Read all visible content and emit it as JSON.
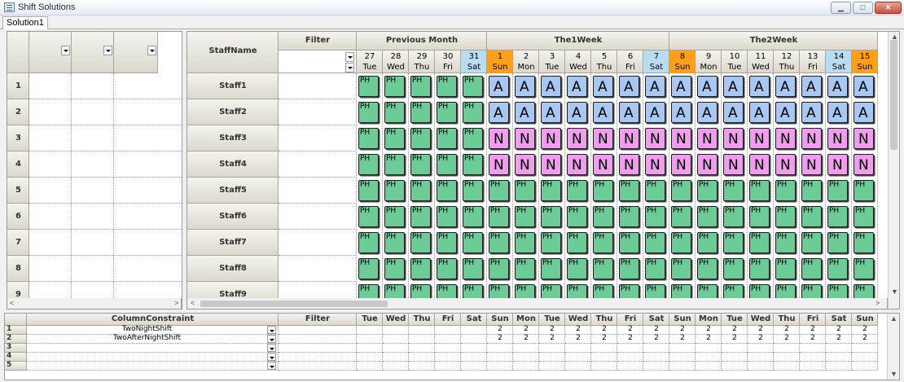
{
  "window": {
    "title": "Shift Solutions",
    "min_glyph": "▁",
    "max_glyph": "□",
    "close_glyph": "✕"
  },
  "tabs": [
    {
      "label": "Solution1"
    }
  ],
  "grid": {
    "staff_header": "StaffName",
    "filter_header": "Filter",
    "week_headers": [
      "Previous Month",
      "The1Week",
      "The2Week"
    ],
    "days": [
      {
        "date": "27",
        "day": "Tue",
        "kind": "prev"
      },
      {
        "date": "28",
        "day": "Wed",
        "kind": "prev"
      },
      {
        "date": "29",
        "day": "Thu",
        "kind": "prev"
      },
      {
        "date": "30",
        "day": "Fri",
        "kind": "prev"
      },
      {
        "date": "31",
        "day": "Sat",
        "kind": "sat"
      },
      {
        "date": "1",
        "day": "Sun",
        "kind": "sun"
      },
      {
        "date": "2",
        "day": "Mon",
        "kind": "wk"
      },
      {
        "date": "3",
        "day": "Tue",
        "kind": "wk"
      },
      {
        "date": "4",
        "day": "Wed",
        "kind": "wk"
      },
      {
        "date": "5",
        "day": "Thu",
        "kind": "wk"
      },
      {
        "date": "6",
        "day": "Fri",
        "kind": "wk"
      },
      {
        "date": "7",
        "day": "Sat",
        "kind": "sat"
      },
      {
        "date": "8",
        "day": "Sun",
        "kind": "sun"
      },
      {
        "date": "9",
        "day": "Mon",
        "kind": "wk"
      },
      {
        "date": "10",
        "day": "Tue",
        "kind": "wk"
      },
      {
        "date": "11",
        "day": "Wed",
        "kind": "wk"
      },
      {
        "date": "12",
        "day": "Thu",
        "kind": "wk"
      },
      {
        "date": "13",
        "day": "Fri",
        "kind": "wk"
      },
      {
        "date": "14",
        "day": "Sat",
        "kind": "sat"
      },
      {
        "date": "15",
        "day": "Sun",
        "kind": "sun"
      }
    ],
    "rows": [
      {
        "num": "1",
        "staff": "Staff1",
        "shifts": [
          "PH",
          "PH",
          "PH",
          "PH",
          "PH",
          "A",
          "A",
          "A",
          "A",
          "A",
          "A",
          "A",
          "A",
          "A",
          "A",
          "A",
          "A",
          "A",
          "A",
          "A"
        ]
      },
      {
        "num": "2",
        "staff": "Staff2",
        "shifts": [
          "PH",
          "PH",
          "PH",
          "PH",
          "PH",
          "A",
          "A",
          "A",
          "A",
          "A",
          "A",
          "A",
          "A",
          "A",
          "A",
          "A",
          "A",
          "A",
          "A",
          "A"
        ]
      },
      {
        "num": "3",
        "staff": "Staff3",
        "shifts": [
          "PH",
          "PH",
          "PH",
          "PH",
          "PH",
          "N",
          "N",
          "N",
          "N",
          "N",
          "N",
          "N",
          "N",
          "N",
          "N",
          "N",
          "N",
          "N",
          "N",
          "N"
        ]
      },
      {
        "num": "4",
        "staff": "Staff4",
        "shifts": [
          "PH",
          "PH",
          "PH",
          "PH",
          "PH",
          "N",
          "N",
          "N",
          "N",
          "N",
          "N",
          "N",
          "N",
          "N",
          "N",
          "N",
          "N",
          "N",
          "N",
          "N"
        ]
      },
      {
        "num": "5",
        "staff": "Staff5",
        "shifts": [
          "PH",
          "PH",
          "PH",
          "PH",
          "PH",
          "PH",
          "PH",
          "PH",
          "PH",
          "PH",
          "PH",
          "PH",
          "PH",
          "PH",
          "PH",
          "PH",
          "PH",
          "PH",
          "PH",
          "PH"
        ]
      },
      {
        "num": "6",
        "staff": "Staff6",
        "shifts": [
          "PH",
          "PH",
          "PH",
          "PH",
          "PH",
          "PH",
          "PH",
          "PH",
          "PH",
          "PH",
          "PH",
          "PH",
          "PH",
          "PH",
          "PH",
          "PH",
          "PH",
          "PH",
          "PH",
          "PH"
        ]
      },
      {
        "num": "7",
        "staff": "Staff7",
        "shifts": [
          "PH",
          "PH",
          "PH",
          "PH",
          "PH",
          "PH",
          "PH",
          "PH",
          "PH",
          "PH",
          "PH",
          "PH",
          "PH",
          "PH",
          "PH",
          "PH",
          "PH",
          "PH",
          "PH",
          "PH"
        ]
      },
      {
        "num": "8",
        "staff": "Staff8",
        "shifts": [
          "PH",
          "PH",
          "PH",
          "PH",
          "PH",
          "PH",
          "PH",
          "PH",
          "PH",
          "PH",
          "PH",
          "PH",
          "PH",
          "PH",
          "PH",
          "PH",
          "PH",
          "PH",
          "PH",
          "PH"
        ]
      },
      {
        "num": "9",
        "staff": "Staff9",
        "shifts": [
          "PH",
          "PH",
          "PH",
          "PH",
          "PH",
          "PH",
          "PH",
          "PH",
          "PH",
          "PH",
          "PH",
          "PH",
          "PH",
          "PH",
          "PH",
          "PH",
          "PH",
          "PH",
          "PH",
          "PH"
        ]
      }
    ]
  },
  "bottom": {
    "constraint_header": "ColumnConstraint",
    "filter_header": "Filter",
    "day_headers": [
      "Tue",
      "Wed",
      "Thu",
      "Fri",
      "Sat",
      "Sun",
      "Mon",
      "Tue",
      "Wed",
      "Thu",
      "Fri",
      "Sat",
      "Sun",
      "Mon",
      "Tue",
      "Wed",
      "Thu",
      "Fri",
      "Sat",
      "Sun"
    ],
    "rows": [
      {
        "num": "1",
        "constraint": "TwoNightShift",
        "values": [
          "",
          "",
          "",
          "",
          "",
          "2",
          "2",
          "2",
          "2",
          "2",
          "2",
          "2",
          "2",
          "2",
          "2",
          "2",
          "2",
          "2",
          "2",
          "2"
        ]
      },
      {
        "num": "2",
        "constraint": "TwoAfterNightShift",
        "values": [
          "",
          "",
          "",
          "",
          "",
          "2",
          "2",
          "2",
          "2",
          "2",
          "2",
          "2",
          "2",
          "2",
          "2",
          "2",
          "2",
          "2",
          "2",
          "2"
        ]
      },
      {
        "num": "3",
        "constraint": "",
        "values": []
      },
      {
        "num": "4",
        "constraint": "",
        "values": []
      },
      {
        "num": "5",
        "constraint": "",
        "values": []
      }
    ]
  },
  "colors": {
    "ph": "#6ccc96",
    "a": "#a8c8f4",
    "n": "#f29cf0",
    "saturday": "#b9dcf0",
    "sunday": "#ff9f1a"
  }
}
